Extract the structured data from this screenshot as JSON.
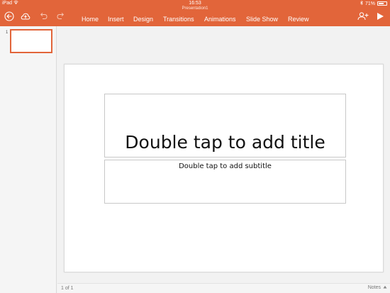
{
  "status_bar": {
    "device": "iPad",
    "time": "16:53",
    "battery": "71%",
    "battery_level": 0.71
  },
  "document": {
    "title": "Presentation1"
  },
  "menu": {
    "tabs": [
      "Home",
      "Insert",
      "Design",
      "Transitions",
      "Animations",
      "Slide Show",
      "Review"
    ]
  },
  "thumbnails": [
    {
      "number": "1"
    }
  ],
  "slide": {
    "title_placeholder": "Double tap to add title",
    "subtitle_placeholder": "Double tap to add subtitle"
  },
  "footer": {
    "page_count": "1 of 1",
    "notes_label": "Notes"
  },
  "colors": {
    "accent": "#e2653a"
  },
  "icons": {
    "back": "back-arrow-icon",
    "save": "save-cloud-icon",
    "undo": "undo-icon",
    "redo": "redo-icon",
    "share": "add-person-icon",
    "play": "play-icon"
  }
}
